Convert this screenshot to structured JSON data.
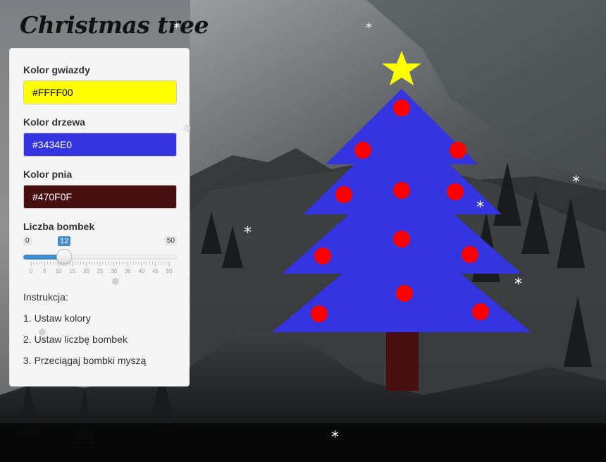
{
  "app": {
    "title": "Christmas tree"
  },
  "controls": {
    "star_color": {
      "label": "Kolor gwiazdy",
      "value": "#FFFF00"
    },
    "tree_color": {
      "label": "Kolor drzewa",
      "value": "#3434E0"
    },
    "trunk_color": {
      "label": "Kolor pnia",
      "value": "#470F0F"
    },
    "baubles": {
      "label": "Liczba bombek",
      "min": 0,
      "max": 50,
      "value": 12,
      "min_label": "0",
      "max_label": "50",
      "value_label": "12",
      "tick_labels": [
        "0",
        "5",
        "10",
        "15",
        "20",
        "25",
        "30",
        "35",
        "40",
        "45",
        "50"
      ]
    }
  },
  "instructions": {
    "heading": "Instrukcja:",
    "steps": [
      "1. Ustaw kolory",
      "2. Ustaw liczbę bombek",
      "3. Przeciągaj bombki myszą"
    ]
  },
  "scene": {
    "star_color": "#FFFF00",
    "tree_color": "#3434E0",
    "trunk_color": "#470F0F",
    "bauble_color": "#FF0000",
    "snowflake_glyph": "*"
  }
}
